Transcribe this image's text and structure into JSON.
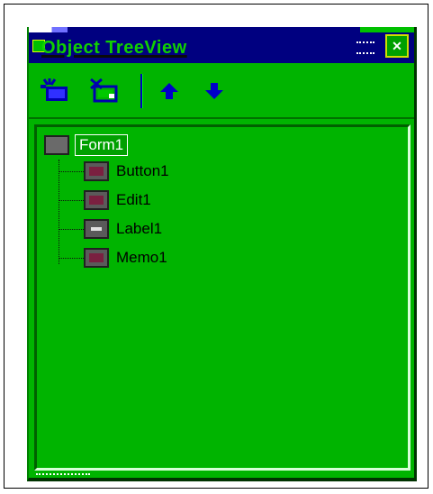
{
  "window": {
    "title": "Object TreeView",
    "close_glyph": "✕"
  },
  "colors": {
    "panel_green": "#00b400",
    "title_blue": "#000080",
    "arrow_blue": "#0000c0"
  },
  "toolbar": {
    "buttons": [
      {
        "name": "add-component-button",
        "icon": "add-component-icon"
      },
      {
        "name": "delete-component-button",
        "icon": "delete-component-icon"
      },
      {
        "name": "move-up-button",
        "icon": "arrow-up-icon"
      },
      {
        "name": "move-down-button",
        "icon": "arrow-down-icon"
      }
    ]
  },
  "tree": {
    "root": {
      "label": "Form1",
      "icon": "form-icon",
      "selected": true
    },
    "children": [
      {
        "label": "Button1",
        "icon": "button-component-icon"
      },
      {
        "label": "Edit1",
        "icon": "edit-component-icon"
      },
      {
        "label": "Label1",
        "icon": "label-component-icon"
      },
      {
        "label": "Memo1",
        "icon": "memo-component-icon"
      }
    ]
  }
}
